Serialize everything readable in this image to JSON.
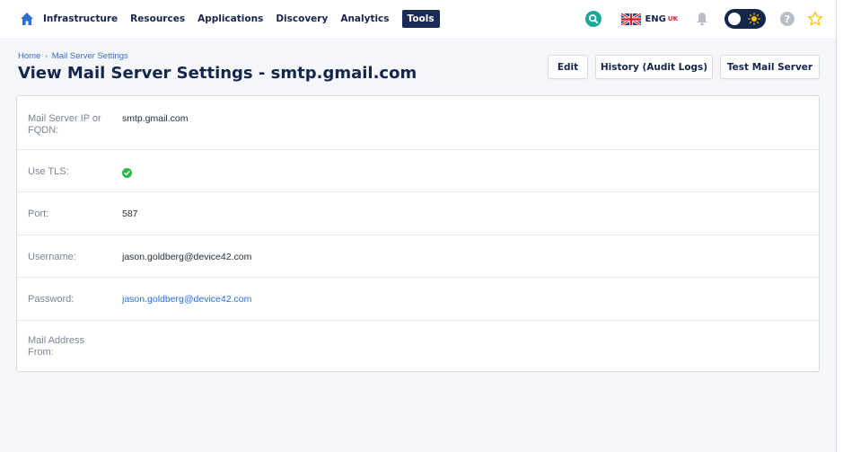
{
  "nav": {
    "items": [
      {
        "label": "Infrastructure"
      },
      {
        "label": "Resources"
      },
      {
        "label": "Applications"
      },
      {
        "label": "Discovery"
      },
      {
        "label": "Analytics"
      },
      {
        "label": "Tools"
      }
    ],
    "active": "Tools",
    "language": "ENG",
    "language_region": "UK"
  },
  "breadcrumb": {
    "home": "Home",
    "separator": "›",
    "current": "Mail Server Settings"
  },
  "page_title": "View Mail Server Settings - smtp.gmail.com",
  "actions": {
    "edit": "Edit",
    "history": "History (Audit Logs)",
    "test": "Test Mail Server"
  },
  "fields": [
    {
      "label": "Mail Server IP or FQDN:",
      "value": "smtp.gmail.com"
    },
    {
      "label": "Use TLS:",
      "value_icon": "check-circle-icon"
    },
    {
      "label": "Port:",
      "value": "587"
    },
    {
      "label": "Username:",
      "value": "jason.goldberg@device42.com"
    },
    {
      "label": "Password:",
      "value": "jason.goldberg@device42.com"
    },
    {
      "label": "Mail Address From:",
      "value": ""
    }
  ],
  "colors": {
    "brand_navy": "#14264a",
    "accent_teal": "#1aa89a",
    "link_blue": "#2a6fd1",
    "success_green": "#2eb84b"
  }
}
